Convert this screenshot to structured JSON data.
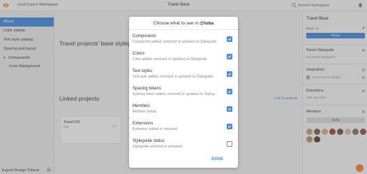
{
  "topbar": {
    "workspace": "Cool Crew's Workspace",
    "title": "Travel Base",
    "search_placeholder": "Search workspace"
  },
  "sidebar": {
    "items": [
      {
        "label": "About",
        "active": true
      },
      {
        "label": "Color palette",
        "active": false
      },
      {
        "label": "Text style catalog",
        "active": false
      },
      {
        "label": "Spacing and layout",
        "active": false
      },
      {
        "label": "Components",
        "active": false
      }
    ],
    "sub_items": [
      "Icons Background"
    ],
    "export_label": "Export Design Tokens"
  },
  "main": {
    "heading": "Travel projects' base styleguide",
    "linked_heading": "Linked projects",
    "link_to_projects": "Link to projects",
    "project_card": {
      "name": "Travel iOS",
      "sub": "iOS",
      "version": "1.6"
    }
  },
  "right_panel": {
    "title": "Travel Base",
    "base_label": "Base, 1x",
    "share_label": "Share",
    "parent_heading": "Parent Styleguide",
    "parent_value": "No parent styleguide",
    "integrations_heading": "Integrations",
    "integrations_value": "Connected to @tuba",
    "extensions_heading": "Extensions",
    "extensions_value": "XML and CSS",
    "members_heading": "Members",
    "invite_label": "Invite",
    "avatar_colors": [
      "#c9a27a",
      "#7a6a5a",
      "#d8b08c",
      "#b04a3a",
      "#6d5f52",
      "#e0c2a0",
      "#8a7b6b",
      "#a3563e",
      "#c4956c",
      "#5a4a3f"
    ]
  },
  "modal": {
    "title_prefix": "Choose what to see in ",
    "team": "@tuba",
    "options": [
      {
        "title": "Components",
        "desc": "Component added, removed or updated on Styleguide",
        "checked": true
      },
      {
        "title": "Colors",
        "desc": "Color added, removed or updated on Styleguide",
        "checked": true
      },
      {
        "title": "Text styles",
        "desc": "Text style added, removed or updated on Styleguide",
        "checked": true
      },
      {
        "title": "Spacing tokens",
        "desc": "Spacing token added, removed or updated on Styleg...",
        "checked": true
      },
      {
        "title": "Members",
        "desc": "Member invited",
        "checked": true
      },
      {
        "title": "Extensions",
        "desc": "Extension added or removed",
        "checked": true
      },
      {
        "title": "Styleguide status",
        "desc": "Styleguide archived or activated",
        "checked": false
      }
    ],
    "done_label": "DONE"
  },
  "colors": {
    "accent": "#4a90e2",
    "logo": "#f28a3e"
  }
}
